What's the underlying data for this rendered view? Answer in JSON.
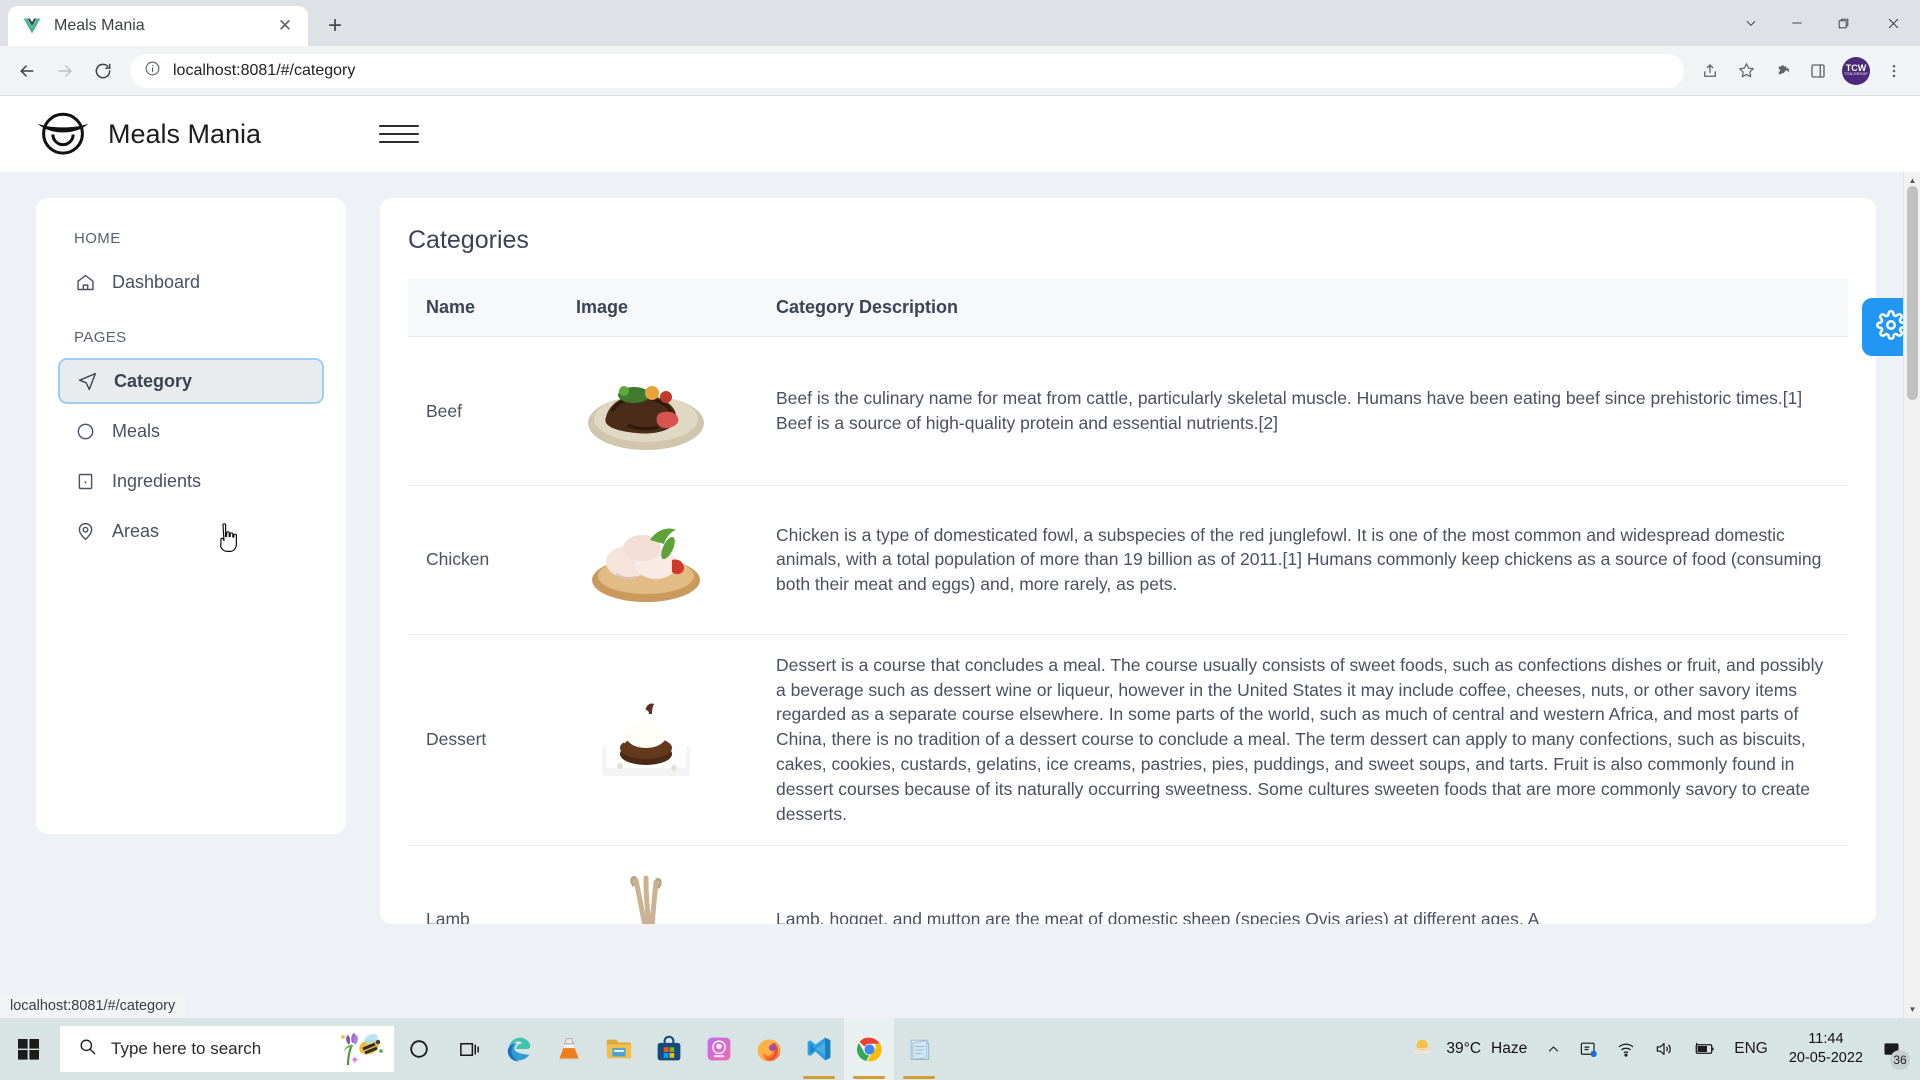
{
  "browser": {
    "tab": {
      "title": "Meals Mania",
      "favicon_icon": "vue-logo-icon",
      "close_icon": "close-icon"
    },
    "new_tab_label": "+",
    "window_controls": {
      "more_icon": "chevron-down-icon",
      "minimize": "—",
      "maximize": "maximize-icon",
      "close": "✕"
    },
    "nav": {
      "back_icon": "arrow-left-icon",
      "forward_icon": "arrow-right-icon",
      "reload_icon": "reload-icon"
    },
    "omnibox": {
      "info_icon": "info-circle-icon",
      "url_host": "localhost:8081",
      "url_path": "/#/category",
      "full_url": "localhost:8081/#/category"
    },
    "toolbar_icons": [
      "share-icon",
      "bookmark-star-icon",
      "extensions-puzzle-icon",
      "side-panel-icon",
      "profile-avatar",
      "kebab-menu-icon"
    ],
    "profile": {
      "initials": "TCW",
      "sub": "TCW-GROUP"
    },
    "status_bar": {
      "text": "localhost:8081/#/category"
    }
  },
  "app": {
    "brand": {
      "name": "Meals Mania",
      "logo_icon": "bowl-logo-icon"
    },
    "menu_toggle_icon": "hamburger-menu-icon",
    "settings_fab_icon": "gear-icon",
    "settings_fab_color": "#2196f3"
  },
  "sidebar": {
    "groups": [
      {
        "label": "HOME",
        "items": [
          {
            "label": "Dashboard",
            "icon": "home-icon",
            "active": false
          }
        ]
      },
      {
        "label": "PAGES",
        "items": [
          {
            "label": "Category",
            "icon": "send-plane-icon",
            "active": true
          },
          {
            "label": "Meals",
            "icon": "circle-icon",
            "active": false
          },
          {
            "label": "Ingredients",
            "icon": "square-dot-icon",
            "active": false
          },
          {
            "label": "Areas",
            "icon": "map-pin-icon",
            "active": false
          }
        ]
      }
    ]
  },
  "main": {
    "title": "Categories",
    "table": {
      "columns": [
        "Name",
        "Image",
        "Category Description"
      ],
      "rows": [
        {
          "name": "Beef",
          "image_alt": "grilled-beef-steak-plate",
          "description": "Beef is the culinary name for meat from cattle, particularly skeletal muscle. Humans have been eating beef since prehistoric times.[1] Beef is a source of high-quality protein and essential nutrients.[2]"
        },
        {
          "name": "Chicken",
          "image_alt": "raw-chicken-drumsticks-bowl",
          "description": "Chicken is a type of domesticated fowl, a subspecies of the red junglefowl. It is one of the most common and widespread domestic animals, with a total population of more than 19 billion as of 2011.[1] Humans commonly keep chickens as a source of food (consuming both their meat and eggs) and, more rarely, as pets."
        },
        {
          "name": "Dessert",
          "image_alt": "chocolate-cake-dessert-plate",
          "description": "Dessert is a course that concludes a meal. The course usually consists of sweet foods, such as confections dishes or fruit, and possibly a beverage such as dessert wine or liqueur, however in the United States it may include coffee, cheeses, nuts, or other savory items regarded as a separate course elsewhere. In some parts of the world, such as much of central and western Africa, and most parts of China, there is no tradition of a dessert course to conclude a meal. The term dessert can apply to many confections, such as biscuits, cakes, cookies, custards, gelatins, ice creams, pastries, pies, puddings, and sweet soups, and tarts. Fruit is also commonly found in dessert courses because of its naturally occurring sweetness. Some cultures sweeten foods that are more commonly savory to create desserts."
        },
        {
          "name": "Lamb",
          "image_alt": "lamb-chops-plate",
          "description": "Lamb, hogget, and mutton are the meat of domestic sheep (species Ovis aries) at different ages. A"
        }
      ]
    }
  },
  "taskbar": {
    "start_icon": "windows-start-icon",
    "search": {
      "placeholder": "Type here to search",
      "icon": "search-icon",
      "decoration_icon": "flower-bee-icon"
    },
    "apps": [
      {
        "name": "cortana-icon",
        "running": false
      },
      {
        "name": "task-view-icon",
        "running": false
      },
      {
        "name": "microsoft-edge-icon",
        "running": false
      },
      {
        "name": "vlc-media-player-icon",
        "running": false
      },
      {
        "name": "file-explorer-icon",
        "running": false
      },
      {
        "name": "microsoft-store-icon",
        "running": false
      },
      {
        "name": "photos-app-icon",
        "running": false
      },
      {
        "name": "firefox-icon",
        "running": false
      },
      {
        "name": "vs-code-icon",
        "running": true
      },
      {
        "name": "google-chrome-icon",
        "running": true,
        "active": true
      },
      {
        "name": "notepad-icon",
        "running": true
      }
    ],
    "tray": {
      "weather": {
        "icon": "haze-sun-icon",
        "temperature": "39°C",
        "condition": "Haze"
      },
      "overflow_icon": "chevron-up-icon",
      "onedrive_icon": "onedrive-icon",
      "wifi_icon": "wifi-icon",
      "volume_icon": "volume-icon",
      "battery_icon": "battery-charging-icon",
      "language": "ENG",
      "time": "11:44",
      "date": "20-05-2022",
      "notifications_icon": "action-center-icon",
      "notifications_count": "36"
    }
  }
}
